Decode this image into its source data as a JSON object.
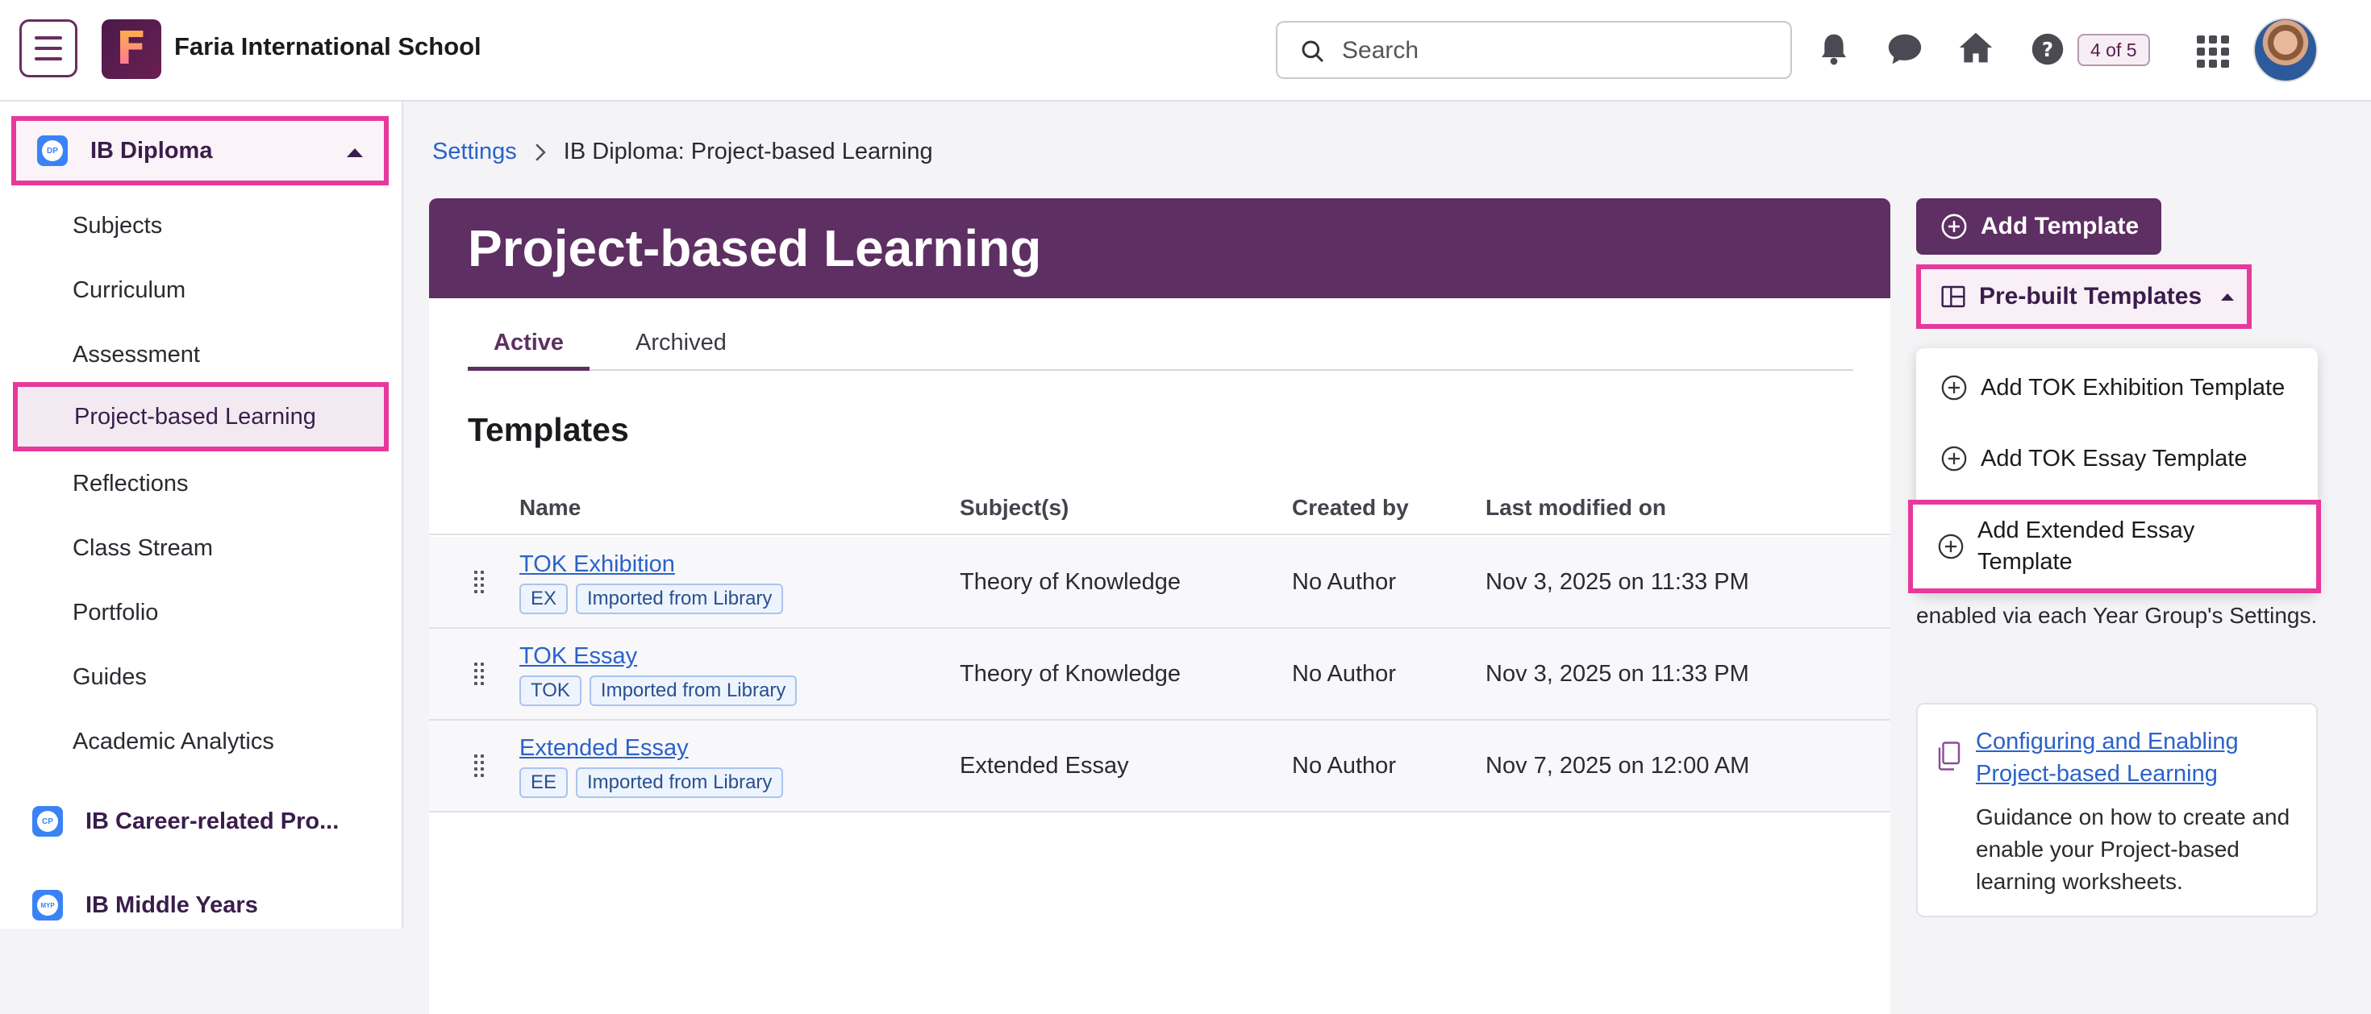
{
  "header": {
    "school_name": "Faria International School",
    "logo_letter": "F",
    "search_placeholder": "Search",
    "counter": "4 of 5"
  },
  "sidebar": {
    "program": "IB Diploma",
    "program_badge": "DP",
    "items": [
      {
        "label": "Subjects"
      },
      {
        "label": "Curriculum"
      },
      {
        "label": "Assessment"
      },
      {
        "label": "Project-based Learning"
      },
      {
        "label": "Reflections"
      },
      {
        "label": "Class Stream"
      },
      {
        "label": "Portfolio"
      },
      {
        "label": "Guides"
      },
      {
        "label": "Academic Analytics"
      }
    ],
    "other_programs": [
      {
        "label": "IB Career-related Pro...",
        "badge": "CP"
      },
      {
        "label": "IB Middle Years",
        "badge": "MYP"
      }
    ]
  },
  "breadcrumb": {
    "parent": "Settings",
    "current": "IB Diploma: Project-based Learning"
  },
  "page": {
    "title": "Project-based Learning",
    "tabs": [
      "Active",
      "Archived"
    ],
    "section_title": "Templates"
  },
  "table": {
    "headers": [
      "Name",
      "Subject(s)",
      "Created by",
      "Last modified on"
    ],
    "rows": [
      {
        "name": "TOK Exhibition",
        "tags": [
          "EX",
          "Imported from Library"
        ],
        "subject": "Theory of Knowledge",
        "created_by": "No Author",
        "modified": "Nov 3, 2025 on 11:33 PM"
      },
      {
        "name": "TOK Essay",
        "tags": [
          "TOK",
          "Imported from Library"
        ],
        "subject": "Theory of Knowledge",
        "created_by": "No Author",
        "modified": "Nov 3, 2025 on 11:33 PM"
      },
      {
        "name": "Extended Essay",
        "tags": [
          "EE",
          "Imported from Library"
        ],
        "subject": "Extended Essay",
        "created_by": "No Author",
        "modified": "Nov 7, 2025 on 12:00 AM"
      }
    ]
  },
  "actions": {
    "add_template": "Add Template",
    "prebuilt_templates": "Pre-built Templates",
    "dropdown": [
      "Add TOK Exhibition Template",
      "Add TOK Essay Template",
      "Add Extended Essay Template"
    ]
  },
  "help_text": "enabled via each Year Group's Settings.",
  "guide": {
    "link": "Configuring and Enabling Project-based Learning",
    "description": "Guidance on how to create and enable your Project-based learning worksheets."
  },
  "colors": {
    "brand": "#5e2f62",
    "highlight": "#e6399b",
    "link": "#2a62c9"
  }
}
